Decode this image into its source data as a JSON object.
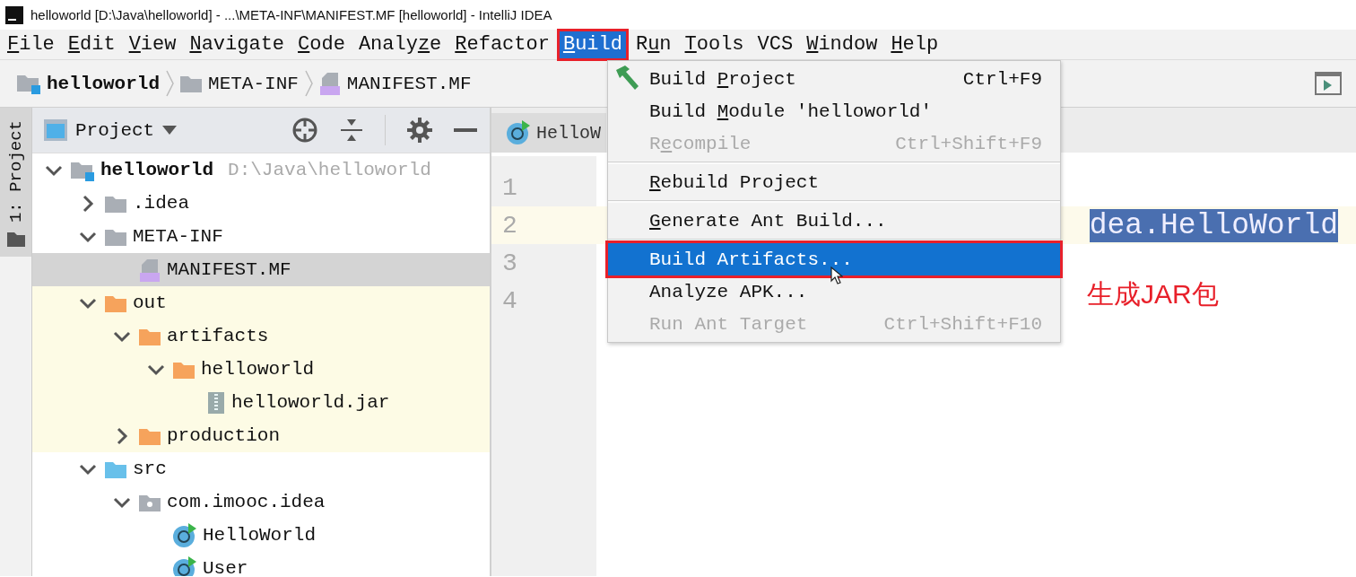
{
  "window": {
    "title": "helloworld [D:\\Java\\helloworld] - ...\\META-INF\\MANIFEST.MF [helloworld] - IntelliJ IDEA"
  },
  "menu_bar": [
    {
      "mnemonic": "F",
      "after": "ile",
      "selected": false,
      "highlighted": false
    },
    {
      "mnemonic": "E",
      "after": "dit",
      "selected": false,
      "highlighted": false
    },
    {
      "mnemonic": "V",
      "after": "iew",
      "selected": false,
      "highlighted": false
    },
    {
      "mnemonic": "N",
      "after": "avigate",
      "selected": false,
      "highlighted": false
    },
    {
      "mnemonic": "C",
      "after": "ode",
      "selected": false,
      "highlighted": false
    },
    {
      "before": "Analy",
      "mnemonic": "z",
      "after": "e",
      "selected": false,
      "highlighted": false
    },
    {
      "mnemonic": "R",
      "after": "efactor",
      "selected": false,
      "highlighted": false
    },
    {
      "mnemonic": "B",
      "after": "uild",
      "selected": true,
      "highlighted": true
    },
    {
      "before": "R",
      "mnemonic": "u",
      "after": "n",
      "selected": false,
      "highlighted": false
    },
    {
      "mnemonic": "T",
      "after": "ools",
      "selected": false,
      "highlighted": false
    },
    {
      "before": "VCS",
      "selected": false,
      "highlighted": false
    },
    {
      "mnemonic": "W",
      "after": "indow",
      "selected": false,
      "highlighted": false
    },
    {
      "mnemonic": "H",
      "after": "elp",
      "selected": false,
      "highlighted": false
    }
  ],
  "breadcrumbs": [
    {
      "label": "helloworld",
      "kind": "module"
    },
    {
      "label": "META-INF",
      "kind": "folder"
    },
    {
      "label": "MANIFEST.MF",
      "kind": "manifest"
    }
  ],
  "side_strip": {
    "label": "1: Project",
    "selected": true
  },
  "project_panel": {
    "title": "Project",
    "tree": [
      {
        "label": "helloworld",
        "kind": "module",
        "path": "D:\\Java\\helloworld",
        "expanded": true,
        "selected": false,
        "excluded": false,
        "children": [
          {
            "label": ".idea",
            "kind": "folder",
            "expanded": false,
            "selected": false,
            "excluded": false
          },
          {
            "label": "META-INF",
            "kind": "folder",
            "expanded": true,
            "selected": false,
            "excluded": false,
            "children": [
              {
                "label": "MANIFEST.MF",
                "kind": "manifest",
                "selected": true,
                "excluded": false
              }
            ]
          },
          {
            "label": "out",
            "kind": "folder",
            "expanded": true,
            "selected": false,
            "excluded": true,
            "children": [
              {
                "label": "artifacts",
                "kind": "folder",
                "expanded": true,
                "selected": false,
                "excluded": true,
                "children": [
                  {
                    "label": "helloworld",
                    "kind": "folder",
                    "expanded": true,
                    "selected": false,
                    "excluded": true,
                    "children": [
                      {
                        "label": "helloworld.jar",
                        "kind": "jar",
                        "selected": false,
                        "excluded": true
                      }
                    ]
                  }
                ]
              },
              {
                "label": "production",
                "kind": "folder",
                "expanded": false,
                "selected": false,
                "excluded": true
              }
            ]
          },
          {
            "label": "src",
            "kind": "source",
            "expanded": true,
            "selected": false,
            "excluded": false,
            "children": [
              {
                "label": "com.imooc.idea",
                "kind": "package",
                "expanded": true,
                "selected": false,
                "excluded": false,
                "children": [
                  {
                    "label": "HelloWorld",
                    "kind": "class",
                    "selected": false,
                    "excluded": false
                  },
                  {
                    "label": "User",
                    "kind": "class",
                    "selected": false,
                    "excluded": false
                  }
                ]
              }
            ]
          }
        ]
      }
    ]
  },
  "editor": {
    "tabs": [
      {
        "label": "HelloW",
        "kind": "class",
        "selected": true
      }
    ],
    "lines": [
      {
        "number": "1",
        "current": false
      },
      {
        "number": "2",
        "current": true,
        "code": "dea.HelloWorld",
        "code_selected": true
      },
      {
        "number": "3",
        "current": false
      },
      {
        "number": "4",
        "current": false
      }
    ]
  },
  "build_menu": [
    {
      "kind": "item",
      "has_icon": true,
      "before": "Build ",
      "mnemonic": "P",
      "after": "roject",
      "shortcut": "Ctrl+F9",
      "disabled": false,
      "selected": false,
      "highlighted": false
    },
    {
      "kind": "item",
      "before": "Build ",
      "mnemonic": "M",
      "after": "odule 'helloworld'",
      "disabled": false,
      "selected": false,
      "highlighted": false
    },
    {
      "kind": "item",
      "before": "R",
      "mnemonic": "e",
      "after": "compile",
      "shortcut": "Ctrl+Shift+F9",
      "disabled": true,
      "selected": false,
      "highlighted": false
    },
    {
      "kind": "separator"
    },
    {
      "kind": "item",
      "mnemonic": "R",
      "after": "ebuild Project",
      "disabled": false,
      "selected": false,
      "highlighted": false
    },
    {
      "kind": "separator"
    },
    {
      "kind": "item",
      "mnemonic": "G",
      "after": "enerate Ant Build...",
      "disabled": false,
      "selected": false,
      "highlighted": false
    },
    {
      "kind": "separator"
    },
    {
      "kind": "item",
      "before": "Build Artifacts...",
      "disabled": false,
      "selected": true,
      "highlighted": true,
      "pointer": true
    },
    {
      "kind": "item",
      "before": "Analyze APK...",
      "disabled": false,
      "selected": false,
      "highlighted": false
    },
    {
      "kind": "item",
      "before": "Run Ant Target",
      "shortcut": "Ctrl+Shift+F10",
      "disabled": true,
      "selected": false,
      "highlighted": false
    }
  ],
  "annotation": {
    "text": "生成JAR包"
  }
}
